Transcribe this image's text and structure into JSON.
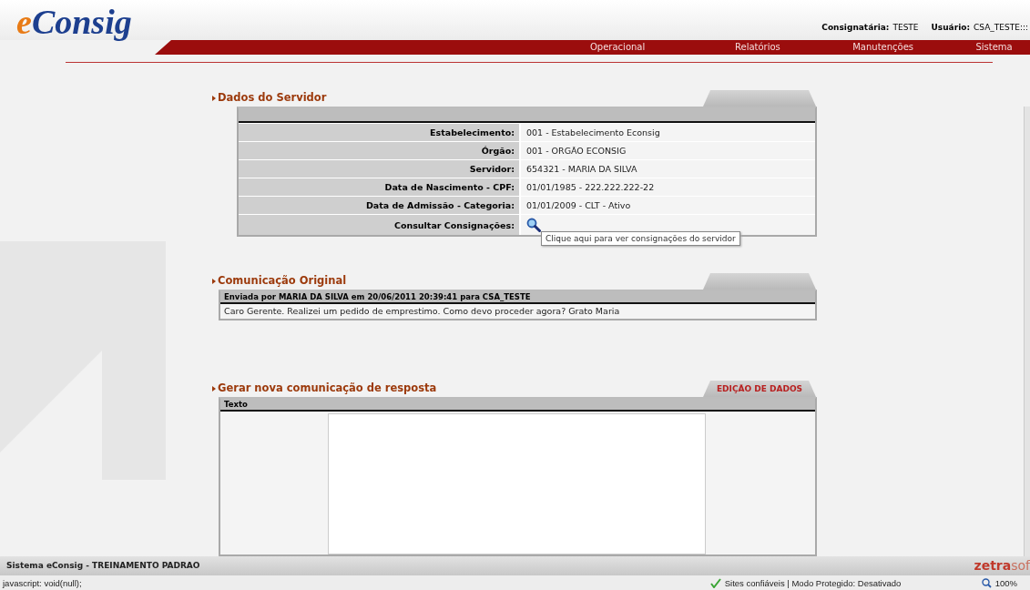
{
  "header": {
    "logo_prefix": "e",
    "logo_main": "Consig",
    "consignataria_label": "Consignatária:",
    "consignataria": "TESTE",
    "usuario_label": "Usuário:",
    "usuario": "CSA_TESTE:::"
  },
  "nav": [
    {
      "label": "Operacional"
    },
    {
      "label": "Relatórios"
    },
    {
      "label": "Manutenções"
    },
    {
      "label": "Sistema"
    }
  ],
  "dados_servidor": {
    "title": "Dados do Servidor",
    "rows": [
      {
        "label": "Estabelecimento:",
        "value": "001 - Estabelecimento Econsig"
      },
      {
        "label": "Órgão:",
        "value": "001 - ORGÃO ECONSIG"
      },
      {
        "label": "Servidor:",
        "value": "654321 - MARIA DA SILVA"
      },
      {
        "label": "Data de Nascimento - CPF:",
        "value": "01/01/1985 - 222.222.222-22"
      },
      {
        "label": "Data de Admissão - Categoria:",
        "value": "01/01/2009 - CLT - Ativo"
      },
      {
        "label": "Consultar Consignações:",
        "kind": "search-link"
      }
    ],
    "tooltip": "Clique aqui para ver consignações do servidor"
  },
  "comunicacao_original": {
    "title": "Comunicação Original",
    "header": "Enviada por MARIA DA SILVA em 20/06/2011 20:39:41 para CSA_TESTE",
    "message": "Caro Gerente. Realizei um pedido de emprestimo. Como devo proceder agora? Grato Maria"
  },
  "nova_comunicacao": {
    "title": "Gerar nova comunicação de resposta",
    "tab": "EDIÇÃO DE DADOS",
    "column": "Texto"
  },
  "footer": {
    "system": "Sistema eConsig - TREINAMENTO PADRAO",
    "brand_main": "zetra",
    "brand_rest": "sof"
  },
  "status_bar": {
    "url": "javascript: void(null);",
    "zone": "Sites confiáveis | Modo Protegido: Desativado",
    "zoom": "100%"
  }
}
